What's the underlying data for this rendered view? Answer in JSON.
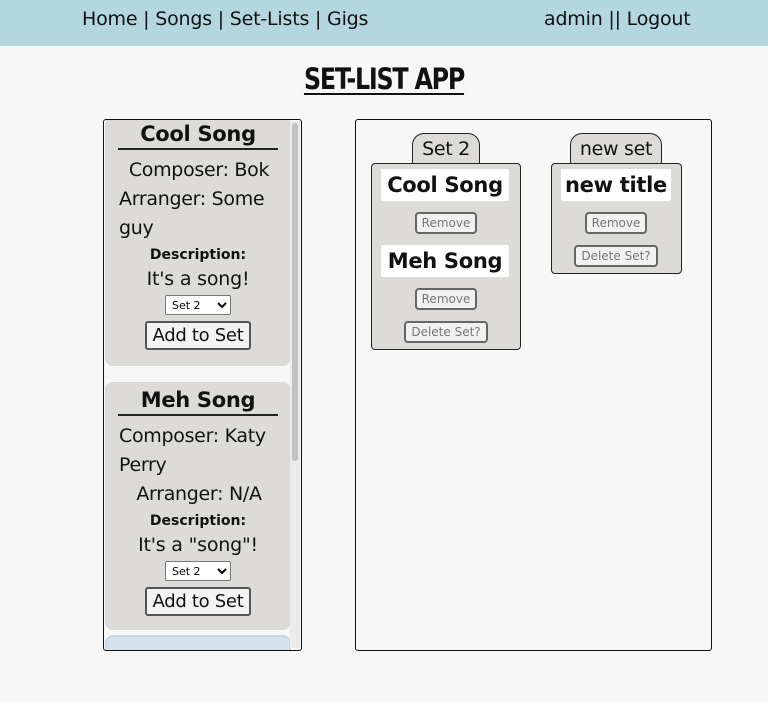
{
  "nav": {
    "home": "Home",
    "songs": "Songs",
    "setlists": "Set-Lists",
    "gigs": "Gigs",
    "separator": "|",
    "user": "admin",
    "user_separator": "||",
    "logout": "Logout"
  },
  "app_title": "SET-LIST APP",
  "songs": [
    {
      "title": "Cool Song",
      "composer": "Composer: Bok",
      "arranger": "Arranger: Some guy",
      "description_label": "Description:",
      "description": "It's a song!",
      "selected_set": "Set 2",
      "add_label": "Add to Set"
    },
    {
      "title": "Meh Song",
      "composer": "Composer: Katy Perry",
      "arranger": "Arranger: N/A",
      "description_label": "Description:",
      "description": "It's a \"song\"!",
      "selected_set": "Set 2",
      "add_label": "Add to Set"
    }
  ],
  "sets": [
    {
      "name": "Set 2",
      "songs": [
        "Cool Song",
        "Meh Song"
      ],
      "remove_label": "Remove",
      "delete_label": "Delete Set?"
    },
    {
      "name": "new set",
      "songs": [
        "new title"
      ],
      "remove_label": "Remove",
      "delete_label": "Delete Set?"
    }
  ],
  "colors": {
    "navbar": "#b3d6df",
    "card": "#dcdbd7",
    "background": "#f7f7f7"
  }
}
